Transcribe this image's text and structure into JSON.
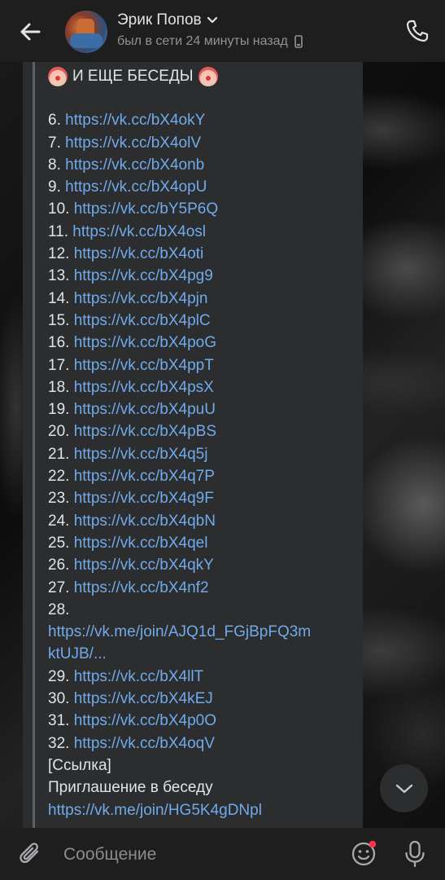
{
  "header": {
    "name": "Эрик Попов",
    "status": "был в сети 24 минуты назад"
  },
  "message": {
    "title": "И ЕЩЕ БЕСЕДЫ",
    "links": [
      {
        "num": "6.",
        "url": "https://vk.cc/bX4okY"
      },
      {
        "num": "7.",
        "url": "https://vk.cc/bX4olV"
      },
      {
        "num": "8.",
        "url": "https://vk.cc/bX4onb"
      },
      {
        "num": "9.",
        "url": "https://vk.cc/bX4opU"
      },
      {
        "num": "10.",
        "url": "https://vk.cc/bY5P6Q"
      },
      {
        "num": "11.",
        "url": "https://vk.cc/bX4osl"
      },
      {
        "num": "12.",
        "url": "https://vk.cc/bX4oti"
      },
      {
        "num": "13.",
        "url": "https://vk.cc/bX4pg9"
      },
      {
        "num": "14.",
        "url": "https://vk.cc/bX4pjn"
      },
      {
        "num": "15.",
        "url": "https://vk.cc/bX4plC"
      },
      {
        "num": "16.",
        "url": "https://vk.cc/bX4poG"
      },
      {
        "num": "17.",
        "url": "https://vk.cc/bX4ppT"
      },
      {
        "num": "18.",
        "url": "https://vk.cc/bX4psX"
      },
      {
        "num": "19.",
        "url": "https://vk.cc/bX4puU"
      },
      {
        "num": "20.",
        "url": "https://vk.cc/bX4pBS"
      },
      {
        "num": "21.",
        "url": "https://vk.cc/bX4q5j"
      },
      {
        "num": "22.",
        "url": "https://vk.cc/bX4q7P"
      },
      {
        "num": "23.",
        "url": "https://vk.cc/bX4q9F"
      },
      {
        "num": "24.",
        "url": "https://vk.cc/bX4qbN"
      },
      {
        "num": "25.",
        "url": "https://vk.cc/bX4qel"
      },
      {
        "num": "26.",
        "url": "https://vk.cc/bX4qkY"
      },
      {
        "num": "27.",
        "url": "https://vk.cc/bX4nf2"
      }
    ],
    "item28_num": "28.",
    "item28_url_line1": "https://vk.me/join/AJQ1d_FGjBpFQ3m",
    "item28_url_line2": "ktUJB/...",
    "links_tail": [
      {
        "num": "29.",
        "url": "https://vk.cc/bX4llT"
      },
      {
        "num": "30.",
        "url": "https://vk.cc/bX4kEJ"
      },
      {
        "num": "31.",
        "url": "https://vk.cc/bX4p0O"
      },
      {
        "num": "32.",
        "url": "https://vk.cc/bX4oqV"
      }
    ],
    "link_label": "[Ссылка]",
    "invite_label": "Приглашение в беседу",
    "invite_url": "https://vk.me/join/HG5K4gDNpl"
  },
  "composer": {
    "placeholder": "Сообщение"
  },
  "colors": {
    "link": "#71aaeb",
    "text": "#e1e3e6",
    "muted": "#939393",
    "bar_bg": "#1e1e1f",
    "bubble_bg": "#2c2d2e",
    "badge": "#ff3347"
  },
  "icons": [
    "back-arrow-icon",
    "chevron-down-icon",
    "mobile-phone-icon",
    "phone-call-icon",
    "clown-emoji-icon",
    "chevron-down-icon",
    "paperclip-icon",
    "emoji-smile-icon",
    "microphone-icon"
  ]
}
